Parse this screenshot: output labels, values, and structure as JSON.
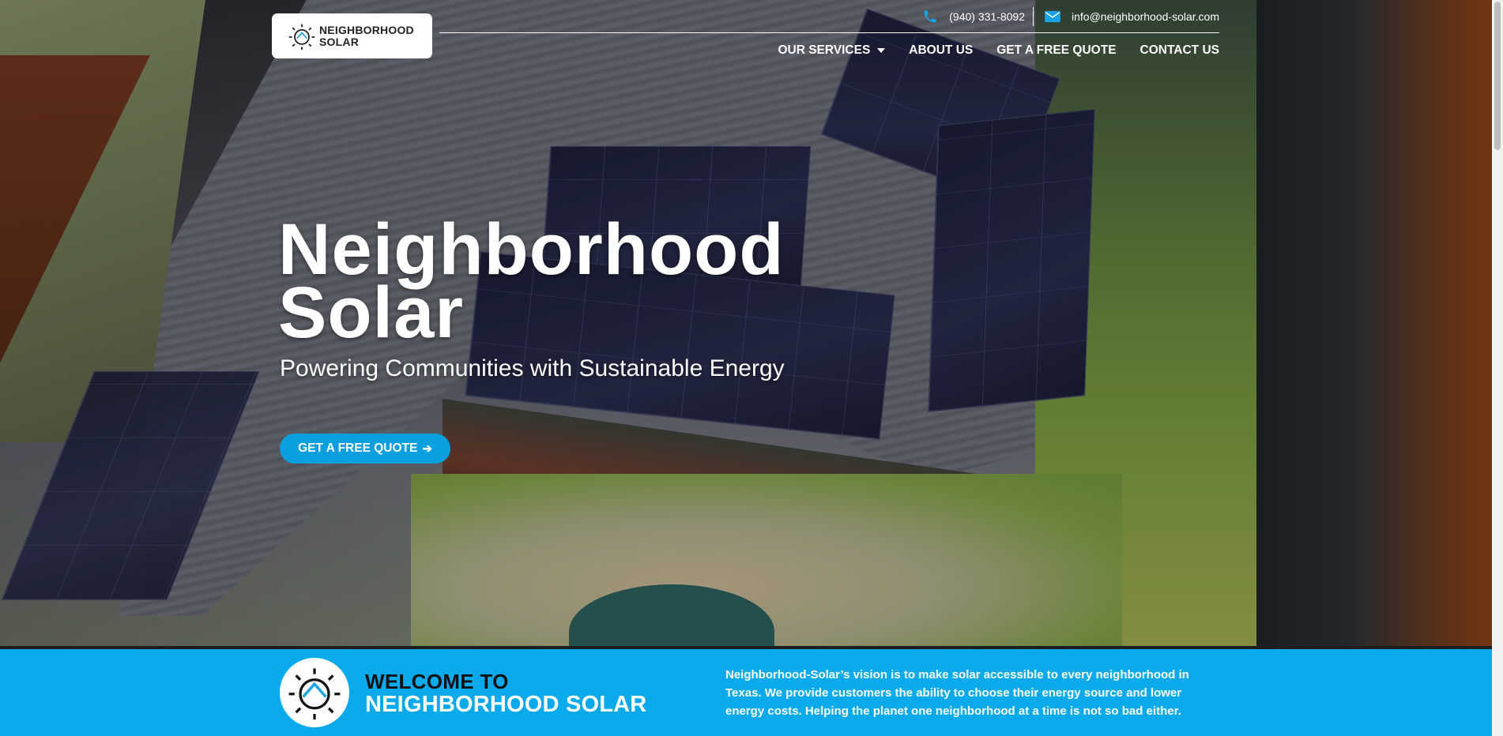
{
  "header": {
    "logo_line1": "NEIGHBORHOOD",
    "logo_line2": "SOLAR",
    "phone": "(940) 331-8092",
    "email": "info@neighborhood-solar.com"
  },
  "nav": {
    "items": [
      {
        "label": "OUR SERVICES",
        "has_dropdown": true
      },
      {
        "label": "ABOUT US"
      },
      {
        "label": "GET A FREE QUOTE"
      },
      {
        "label": "CONTACT US"
      }
    ]
  },
  "hero": {
    "title_line1": "Neighborhood",
    "title_line2": "Solar",
    "subtitle": "Powering Communities with Sustainable Energy",
    "cta_label": "GET A FREE QUOTE",
    "cta_icon": "arrow-right-icon"
  },
  "welcome": {
    "line1": "WELCOME TO",
    "line2": "NEIGHBORHOOD SOLAR",
    "vision": "Neighborhood-Solar’s vision is to make solar accessible to every neighborhood in Texas. We provide customers the ability to choose their energy source and lower energy costs. Helping the planet one neighborhood at a time is not so bad either."
  },
  "colors": {
    "accent": "#08aaeb",
    "button": "#0a9fde",
    "text_light": "#ffffff",
    "text_dark": "#111111"
  },
  "icons": [
    "phone-icon",
    "envelope-icon",
    "sun-house-icon",
    "chevron-down-icon",
    "arrow-right-icon"
  ]
}
